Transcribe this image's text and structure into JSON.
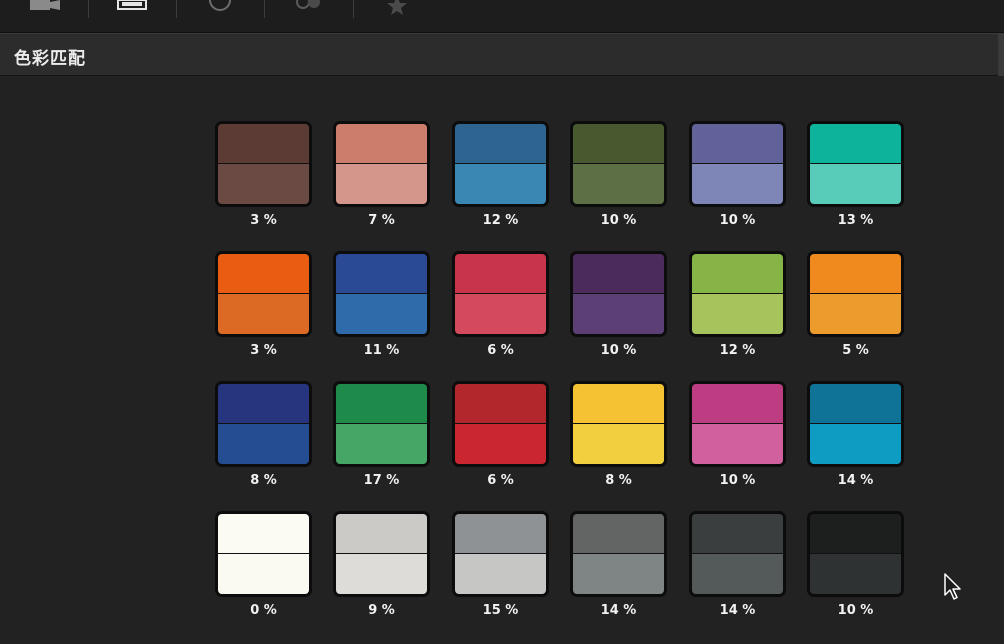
{
  "panel": {
    "title": "色彩匹配"
  },
  "toolbar": {
    "icons": [
      "camera-icon",
      "film-icon",
      "circle-icon",
      "toggle-icon",
      "star-icon"
    ]
  },
  "swatches": [
    {
      "top": "#5b3b34",
      "bottom": "#6a4a42",
      "percent": "3 %"
    },
    {
      "top": "#cc7d6c",
      "bottom": "#d4968a",
      "percent": "7 %"
    },
    {
      "top": "#2e6590",
      "bottom": "#3b87b3",
      "percent": "12 %"
    },
    {
      "top": "#48582f",
      "bottom": "#5d7045",
      "percent": "10 %"
    },
    {
      "top": "#62629a",
      "bottom": "#7d86b7",
      "percent": "10 %"
    },
    {
      "top": "#0eb39b",
      "bottom": "#58cbb9",
      "percent": "13 %"
    },
    {
      "top": "#e85d12",
      "bottom": "#dd6a24",
      "percent": "3 %"
    },
    {
      "top": "#2a4a96",
      "bottom": "#2f6aaa",
      "percent": "11 %"
    },
    {
      "top": "#c8354a",
      "bottom": "#d24a5c",
      "percent": "6 %"
    },
    {
      "top": "#4b2a5c",
      "bottom": "#5c4075",
      "percent": "10 %"
    },
    {
      "top": "#86b446",
      "bottom": "#a7c45c",
      "percent": "12 %"
    },
    {
      "top": "#f08a1e",
      "bottom": "#ec9c2c",
      "percent": "5 %"
    },
    {
      "top": "#27357e",
      "bottom": "#254e92",
      "percent": "8 %"
    },
    {
      "top": "#1e8b4a",
      "bottom": "#45a665",
      "percent": "17 %"
    },
    {
      "top": "#b1272c",
      "bottom": "#c9262f",
      "percent": "6 %"
    },
    {
      "top": "#f4c232",
      "bottom": "#f2cf3e",
      "percent": "8 %"
    },
    {
      "top": "#bc3d82",
      "bottom": "#d1609f",
      "percent": "10 %"
    },
    {
      "top": "#0e7397",
      "bottom": "#0f9cc2",
      "percent": "14 %"
    },
    {
      "top": "#fbfaf3",
      "bottom": "#fbfaf2",
      "percent": "0 %"
    },
    {
      "top": "#cbcac7",
      "bottom": "#dddcd8",
      "percent": "9 %"
    },
    {
      "top": "#8e9295",
      "bottom": "#c6c7c5",
      "percent": "15 %"
    },
    {
      "top": "#636565",
      "bottom": "#7f8585",
      "percent": "14 %"
    },
    {
      "top": "#3a3e3e",
      "bottom": "#535a59",
      "percent": "14 %"
    },
    {
      "top": "#1d1e1e",
      "bottom": "#2f3232",
      "percent": "10 %"
    }
  ]
}
